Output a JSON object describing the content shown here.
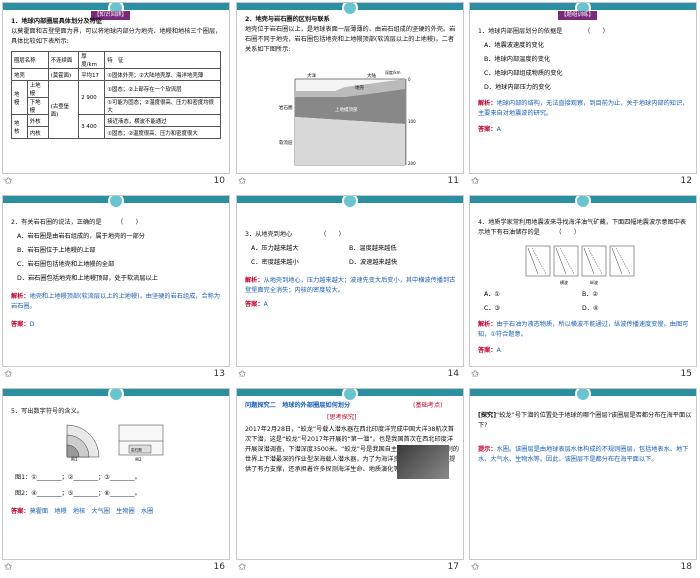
{
  "slides": [
    {
      "page": "10",
      "tag": "【知识回顾】",
      "heading": "1．地球内部圈层具体划分及特征",
      "intro": "以莫霍面和古登堡面为界，可以将地球内部分为地壳、地幔和地核三个圈层，具体比较如下表所示:",
      "table_headers": [
        "圈层名称",
        "不连续面",
        "厚度/km",
        "特　征"
      ],
      "rows": [
        {
          "c1": "地壳",
          "c2": "(莫霍面)",
          "c3": "平均17",
          "c4": "①固体外壳；②大陆地壳厚、海洋地壳薄"
        },
        {
          "c1": "上地幔",
          "c2": "",
          "c3": "2 900",
          "c4": "①固态；②上部存在一个软流层"
        },
        {
          "c1": "下地幔",
          "c2": "",
          "c3": "",
          "c4": "①可能为固态；②温度很高、压力和密度均很大"
        },
        {
          "c1": "外核",
          "c2": "(古登堡面)",
          "c3": "3 400",
          "c4": "接近液态，横波不能通过"
        },
        {
          "c1": "内核",
          "c2": "",
          "c3": "",
          "c4": "①固态；②温度很高、压力和密度很大"
        }
      ],
      "side_labels": [
        "地幔",
        "地核"
      ]
    },
    {
      "page": "11",
      "heading": "2．地壳与岩石圈的区别与联系",
      "body": "地壳位于岩石圈以上，是地球表面一层薄薄的、由岩石组成的坚硬的外壳。岩石圈不同于地壳，岩石圈包括地壳和上地幔顶部(软流层以上的上地幔)。二者关系如下图所示:",
      "fig_labels": [
        "大洋",
        "大陆",
        "岩石圈",
        "地壳",
        "上地幔顶部",
        "软流层",
        "深度/km",
        "0",
        "100",
        "200"
      ]
    },
    {
      "page": "12",
      "tag": "【题组训练】",
      "question": "1．地球内部圈层划分的依据是　　　　（　　）",
      "options": [
        "A．地震波速度的变化",
        "B．地球内部温度的变化",
        "C．地球内部组成物质的变化",
        "D．地球内部压力的变化"
      ],
      "analysis_label": "解析：",
      "analysis": "地球内部的结构，无法直接观察，到目前为止，关于地球内部的知识，主要来自对地震波的研究。",
      "answer_label": "答案：",
      "answer": "A"
    },
    {
      "page": "13",
      "question": "2．有关岩石圈的说法，正确的是　　　（　　）",
      "options": [
        "A．岩石圈是由岩石组成的，属于地壳的一部分",
        "B．岩石圈位于上地幔的上部",
        "C．岩石圈包括地壳和上地幔的全部",
        "D．岩石圈包括地壳和上地幔顶部，处于软流层以上"
      ],
      "analysis_label": "解析：",
      "analysis": "地壳和上地幔顶部(软流层以上的上地幔)，由坚硬的岩石组成，合称为岩石圈。",
      "answer_label": "答案：",
      "answer": "D"
    },
    {
      "page": "14",
      "question": "3．从地壳到地心　　　　　（　　）",
      "options": [
        "A．压力越来越大",
        "B．温度越来越低",
        "C．密度越来越小",
        "D．波速越来越快"
      ],
      "analysis_label": "解析：",
      "analysis": "从地壳到地心，压力越来越大；波速先变大后变小，其中横波传播到古登堡面完全消失；内核的密度较大。",
      "answer_label": "答案：",
      "answer": "A"
    },
    {
      "page": "15",
      "question": "4．地质学家常利用地震波来寻找海洋油气矿藏，下面四幅地震波示意图中表示地下有石油储存的是　　　（　　）",
      "options": [
        "A．①",
        "B．②",
        "C．③",
        "D．④"
      ],
      "legend": [
        "横波",
        "纵波"
      ],
      "analysis_label": "解析：",
      "analysis": "由于石油为液态物质，所以横波不能通过，纵波传播速度变慢。由图可知，①符合题意。",
      "answer_label": "答案：",
      "answer": "A"
    },
    {
      "page": "16",
      "question": "5．写出数字符号的含义。",
      "fig_labels": [
        "图1",
        "图2",
        "岩石圈"
      ],
      "fill1": "图1：①________；②________；③________。",
      "fill2": "图2：④________；⑤________；⑥________。",
      "answer_label": "答案：",
      "answer": "莫霍面　地幔　地核　大气圈　生物圈　水圈"
    },
    {
      "page": "17",
      "title": "问题探究二　地球的外部圈层如何划分",
      "level": "(基础考点)",
      "tag": "[思考探究]",
      "body": "2017年2月28日，“蛟龙”号载人潜水器在西北印度洋完成中国大洋38航次首次下潜，这是“蛟龙”号2017年开展的“第一潜”。也是我国首次在西北印度洋开展深潜调查，下潜深度3500米。“蛟龙”号是我国自主设计、自主集成研制的世界上下潜最深的作业型深海载人潜水器，为了为海洋资源开发、环境保护提供了有力支撑，还承担着许多探测海洋生命、地质演化等科学研究使命。"
    },
    {
      "page": "18",
      "q_label": "[探究]",
      "question": "“蛟龙”号下潜的位置处于地球的哪个圈层?该圈层是否都分布在海平面以下?",
      "hint_label": "提示：",
      "hint": "水圈。该圈层是由地球表层水体构成的不规则圈层，包括地表水、地下水、大气水、生物水等。因此，该圈层不是都分布在海平面以下。"
    }
  ]
}
